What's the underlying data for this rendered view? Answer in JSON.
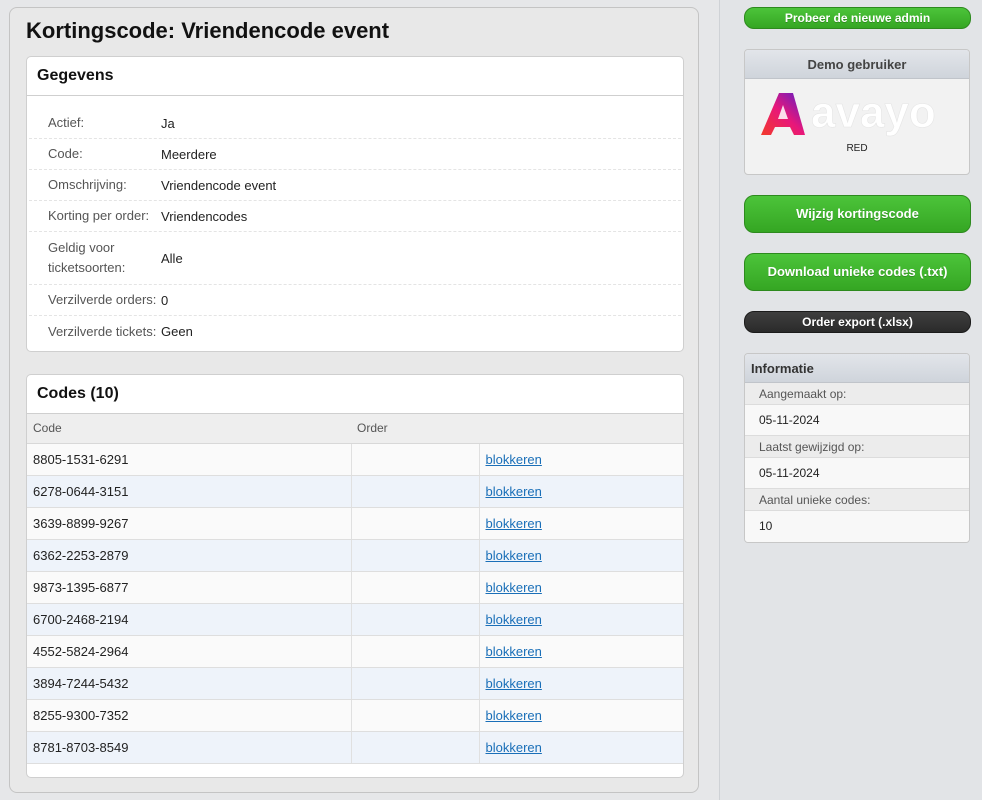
{
  "title": "Kortingscode: Vriendencode event",
  "gegevens": {
    "header": "Gegevens",
    "rows": [
      {
        "label": "Actief:",
        "value": "Ja"
      },
      {
        "label": "Code:",
        "value": "Meerdere"
      },
      {
        "label": "Omschrijving:",
        "value": "Vriendencode event"
      },
      {
        "label": "Korting per order:",
        "value": "Vriendencodes"
      },
      {
        "label": "Geldig voor ticketsoorten:",
        "value": "Alle"
      },
      {
        "label": "Verzilverde orders:",
        "value": "0"
      },
      {
        "label": "Verzilverde tickets:",
        "value": "Geen"
      }
    ]
  },
  "codes": {
    "header": "Codes (10)",
    "columns": [
      "Code",
      "Order",
      ""
    ],
    "rows": [
      {
        "code": "8805-1531-6291",
        "order": "",
        "action": "blokkeren"
      },
      {
        "code": "6278-0644-3151",
        "order": "",
        "action": "blokkeren"
      },
      {
        "code": "3639-8899-9267",
        "order": "",
        "action": "blokkeren"
      },
      {
        "code": "6362-2253-2879",
        "order": "",
        "action": "blokkeren"
      },
      {
        "code": "9873-1395-6877",
        "order": "",
        "action": "blokkeren"
      },
      {
        "code": "6700-2468-2194",
        "order": "",
        "action": "blokkeren"
      },
      {
        "code": "4552-5824-2964",
        "order": "",
        "action": "blokkeren"
      },
      {
        "code": "3894-7244-5432",
        "order": "",
        "action": "blokkeren"
      },
      {
        "code": "8255-9300-7352",
        "order": "",
        "action": "blokkeren"
      },
      {
        "code": "8781-8703-8549",
        "order": "",
        "action": "blokkeren"
      }
    ]
  },
  "sidebar": {
    "try_new_admin": "Probeer de nieuwe admin",
    "demo": {
      "header": "Demo gebruiker",
      "logo_text": "avayo",
      "caption": "RED"
    },
    "edit_button": "Wijzig kortingscode",
    "download_button": "Download unieke codes (.txt)",
    "export_button": "Order export (.xlsx)",
    "info": {
      "header": "Informatie",
      "items": [
        {
          "label": "Aangemaakt op:",
          "value": "05-11-2024"
        },
        {
          "label": "Laatst gewijzigd op:",
          "value": "05-11-2024"
        },
        {
          "label": "Aantal unieke codes:",
          "value": "10"
        }
      ]
    }
  },
  "colors": {
    "accent_green": "#3db52b",
    "dark_button": "#333333",
    "link": "#1a6fb8"
  }
}
